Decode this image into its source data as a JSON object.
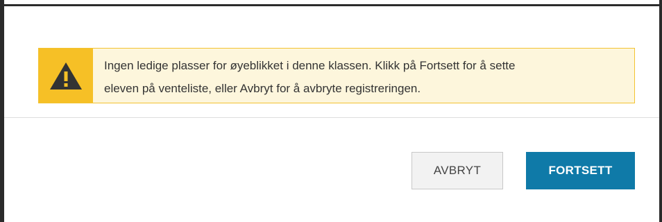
{
  "alert": {
    "icon": "warning-triangle-icon",
    "message_line1": "Ingen ledige plasser for øyeblikket i denne klassen. Klikk på Fortsett for å sette",
    "message_line2": "eleven på venteliste, eller Avbryt for å avbryte registreringen.",
    "colors": {
      "icon_bg": "#f6c026",
      "bg": "#fdf6dc",
      "border": "#f2c230"
    }
  },
  "actions": {
    "cancel_label": "AVBRYT",
    "continue_label": "FORTSETT",
    "continue_color": "#0f7aa8"
  }
}
